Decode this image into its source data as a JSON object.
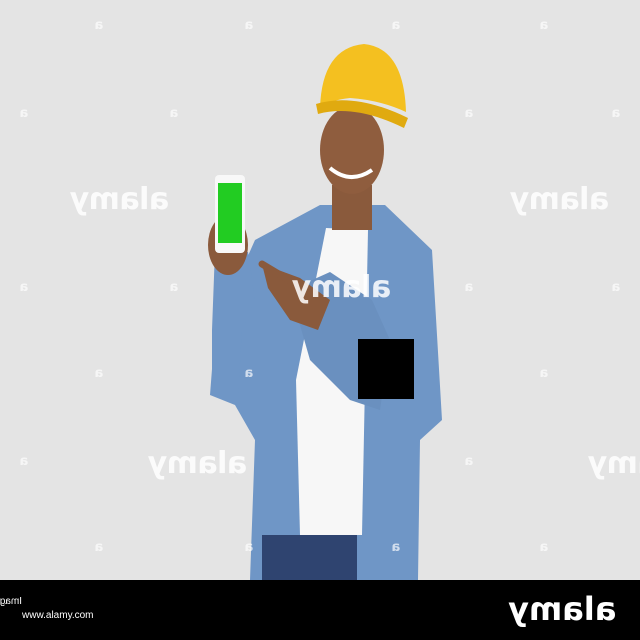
{
  "photo": {
    "description_icon": "man-in-hardhat-holding-phone",
    "phone_screen_color": "#22cc22",
    "hardhat_color": "#f4c020",
    "shirt_color": "#6f96c6"
  },
  "watermark": {
    "large_text": "alamy",
    "small_text": "a"
  },
  "footer": {
    "image_id": "Image ID: 2DCH0P8",
    "url": "www.alamy.com",
    "logo": "alamy"
  }
}
